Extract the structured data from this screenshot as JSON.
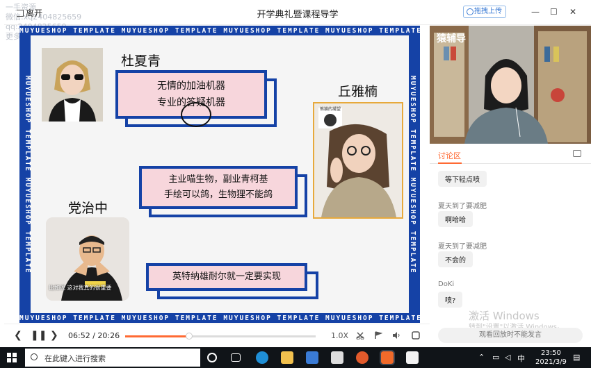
{
  "window": {
    "leave_label": "离开",
    "title": "开学典礼暨课程导学",
    "feedback_label": "拖拽上传",
    "minimize": "—",
    "maximize": "☐",
    "close": "✕"
  },
  "watermark": [
    "一手资源",
    "微信:xq2404825659",
    "qq:2404825659",
    "更多课程请加我哦"
  ],
  "slide": {
    "band_text": "MUYUESHOP TEMPLATE   MUYUESHOP TEMPLATE   MUYUESHOP TEMPLATE   MUYUESHOP TEMPLATE",
    "band_vertical": "MUYUESHOP TEMPLATE MUYUESHOP TEMPLATE",
    "person1": {
      "name": "杜夏青",
      "line1": "无情的加油机器",
      "line2": "专业的答疑机器"
    },
    "person2": {
      "name": "丘雅楠",
      "sticker": "熊猫的凝望"
    },
    "person3": {
      "name": "党治中",
      "caption": "比如说 这对我真的很重要"
    },
    "card_middle": {
      "line1": "主业喵生物，副业青柯基",
      "line2": "手绘可以鸽，生物狸不能鸽"
    },
    "card_bottom": {
      "line1": "英特纳雄耐尔就一定要实现"
    }
  },
  "camera": {
    "logo": "猿辅导"
  },
  "chat": {
    "tab_label": "讨论区",
    "messages": [
      {
        "name": "",
        "text": "等下轻点喷"
      },
      {
        "name": "夏天到了要减肥",
        "text": "啊哈哈"
      },
      {
        "name": "夏天到了要减肥",
        "text": "不会的"
      },
      {
        "name": "DoKi",
        "text": "喷?"
      }
    ],
    "input_placeholder": "观看回放时不能发言",
    "activate_title": "激活 Windows",
    "activate_sub": "转到\"设置\"以激活 Windows。"
  },
  "player": {
    "current": "06:52",
    "separator": "/",
    "total": "20:26",
    "progress": 0.336,
    "speed": "1.0X"
  },
  "taskbar": {
    "search_placeholder": "在此键入进行搜索",
    "ime": "中",
    "time": "23:50",
    "date": "2021/3/9"
  },
  "colors": {
    "slide_blue": "#1542a6",
    "card_pink": "#f7d6dc",
    "accent_orange": "#ff6a33"
  }
}
